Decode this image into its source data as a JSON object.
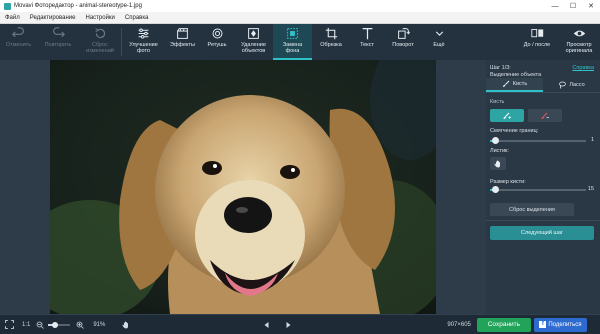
{
  "window": {
    "title": "Movavi Фоторедактор - animal-stereotype-1.jpg",
    "controls": [
      "—",
      "☐",
      "✕"
    ]
  },
  "menu": [
    "Файл",
    "Редактирование",
    "Настройки",
    "Справка"
  ],
  "toolbar": {
    "undo": "Отменить",
    "redo": "Повторить",
    "reset_lines": [
      "Сброс",
      "изменений"
    ],
    "improve_lines": [
      "Улучшение",
      "фото"
    ],
    "effects": "Эффекты",
    "retouch": "Ретушь",
    "remove_lines": [
      "Удаление",
      "объектов"
    ],
    "replace_bg_lines": [
      "Замена",
      "фона"
    ],
    "crop": "Обрезка",
    "text": "Текст",
    "rotate": "Поворот",
    "more": "Ещё",
    "before_after": "До / после",
    "preview_lines": [
      "Просмотр",
      "оригинала"
    ]
  },
  "panel": {
    "step_line1": "Шаг 1/3:",
    "step_line2": "Выделение объекта",
    "help_link": "Справка",
    "tab_brush": "Кисть",
    "tab_lasso": "Лассо",
    "section_brush": "Кисть",
    "smoothing_label": "Смягчение границ:",
    "smoothing_value": "1",
    "smoothing_level": 0.05,
    "hand_label": "Листик:",
    "size_label": "Размер кисти:",
    "size_value": "15",
    "size_level": 0.05,
    "reset_selection": "Сброс выделения",
    "next_step": "Следующий шаг"
  },
  "status": {
    "ratio": "1:1",
    "zoom": "91%",
    "dimensions": "907×605",
    "save": "Сохранить",
    "share": "Поделиться"
  },
  "colors": {
    "accent": "#2fc1c8",
    "save_green": "#21a35a",
    "share_blue": "#2e6bd1"
  }
}
